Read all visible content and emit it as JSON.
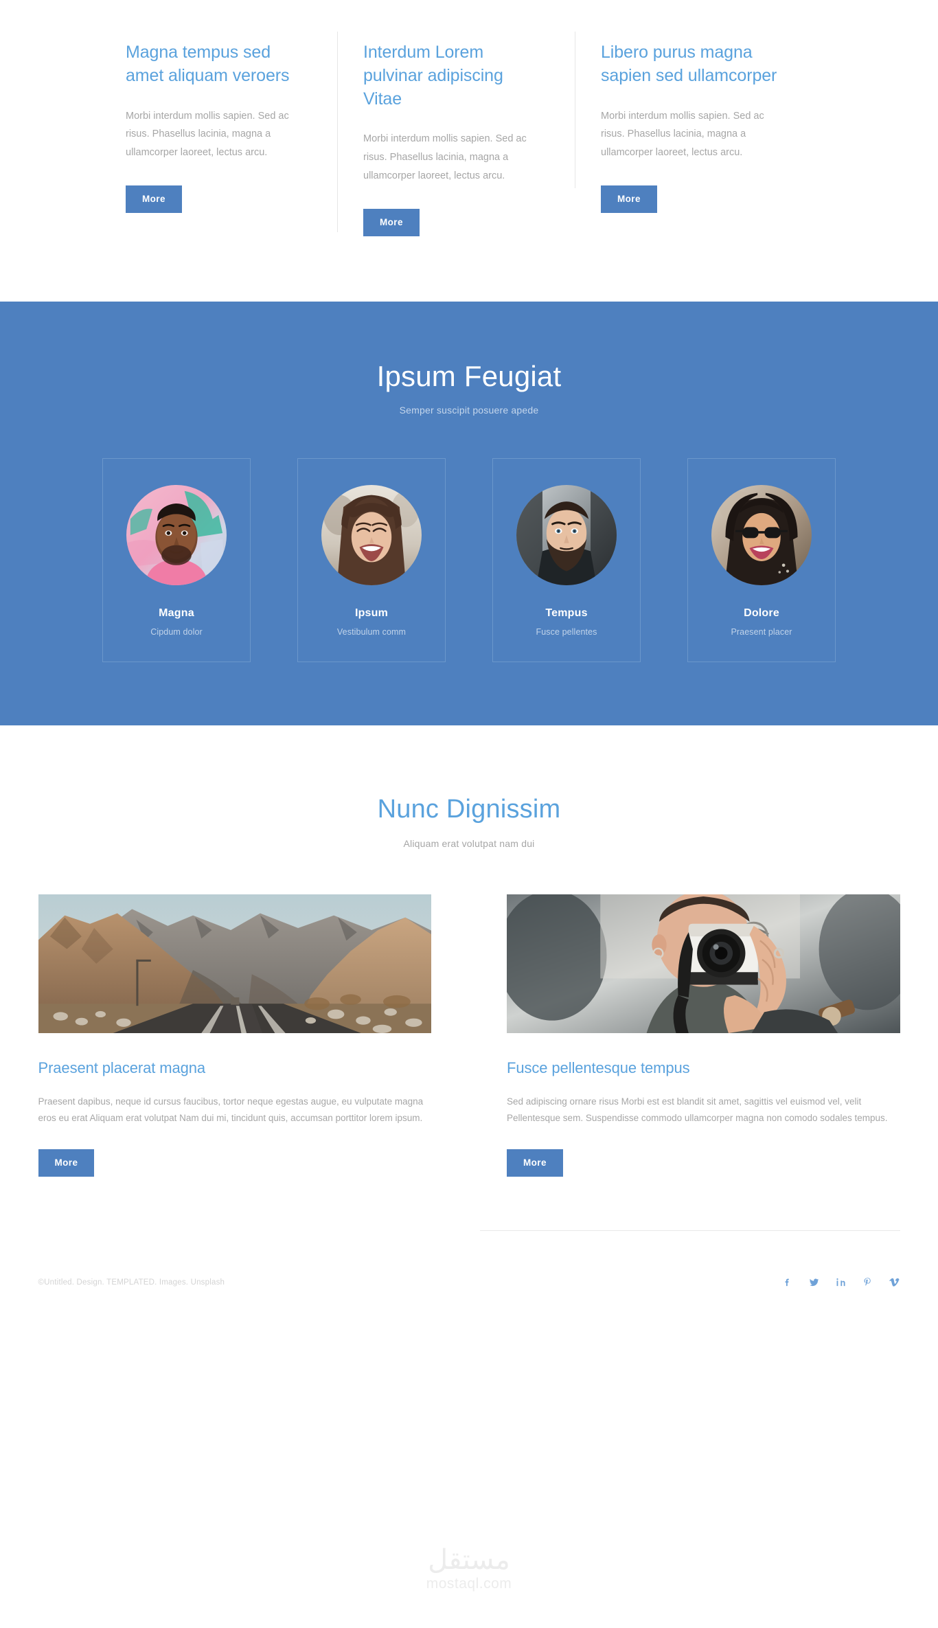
{
  "theme": {
    "accent_blue": "#4e80bf",
    "link_blue": "#5aa2dd",
    "band_bg": "#4e80bf",
    "muted_text": "#a6a6a6",
    "page_bg": "#ffffff"
  },
  "features": {
    "columns": [
      {
        "title": "Magna tempus sed amet aliquam veroers",
        "body": "Morbi interdum mollis sapien. Sed ac risus. Phasellus lacinia, magna a ullamcorper laoreet, lectus arcu.",
        "button": "More"
      },
      {
        "title": "Interdum Lorem pulvinar adipiscing Vitae",
        "body": "Morbi interdum mollis sapien. Sed ac risus. Phasellus lacinia, magna a ullamcorper laoreet, lectus arcu.",
        "button": "More"
      },
      {
        "title": "Libero purus magna sapien sed ullamcorper",
        "body": "Morbi interdum mollis sapien. Sed ac risus. Phasellus lacinia, magna a ullamcorper laoreet, lectus arcu.",
        "button": "More"
      }
    ]
  },
  "team": {
    "title": "Ipsum Feugiat",
    "subtitle": "Semper suscipit posuere apede",
    "members": [
      {
        "name": "Magna",
        "role": "Cipdum dolor",
        "avatar": "portrait-man-graffiti"
      },
      {
        "name": "Ipsum",
        "role": "Vestibulum comm",
        "avatar": "portrait-woman-laughing"
      },
      {
        "name": "Tempus",
        "role": "Fusce pellentes",
        "avatar": "portrait-bearded-man"
      },
      {
        "name": "Dolore",
        "role": "Praesent placer",
        "avatar": "portrait-woman-sunglasses"
      }
    ]
  },
  "posts": {
    "title": "Nunc Dignissim",
    "subtitle": "Aliquam erat volutpat nam dui",
    "items": [
      {
        "image": "desert-mountain-road-photo",
        "title": "Praesent placerat magna",
        "body": "Praesent dapibus, neque id cursus faucibus, tortor neque egestas augue, eu vulputate magna eros eu erat Aliquam erat volutpat Nam dui mi, tincidunt quis, accumsan porttitor lorem ipsum.",
        "button": "More"
      },
      {
        "image": "photographer-with-camera-photo",
        "title": "Fusce pellentesque tempus",
        "body": "Sed adipiscing ornare risus Morbi est est blandit sit amet, sagittis vel euismod vel, velit Pellentesque sem. Suspendisse commodo ullamcorper magna non comodo sodales tempus.",
        "button": "More"
      }
    ]
  },
  "footer": {
    "copyright": "©Untitled. Design. TEMPLATED. Images. Unsplash",
    "social": [
      {
        "network": "facebook",
        "icon": "facebook-icon",
        "label": "f"
      },
      {
        "network": "twitter",
        "icon": "twitter-icon",
        "label": "t"
      },
      {
        "network": "linkedin",
        "icon": "linkedin-icon",
        "label": "in"
      },
      {
        "network": "pinterest",
        "icon": "pinterest-icon",
        "label": "p"
      },
      {
        "network": "vimeo",
        "icon": "vimeo-icon",
        "label": "v"
      }
    ]
  },
  "watermark": {
    "arabic": "مستقل",
    "latin": "mostaql.com"
  }
}
